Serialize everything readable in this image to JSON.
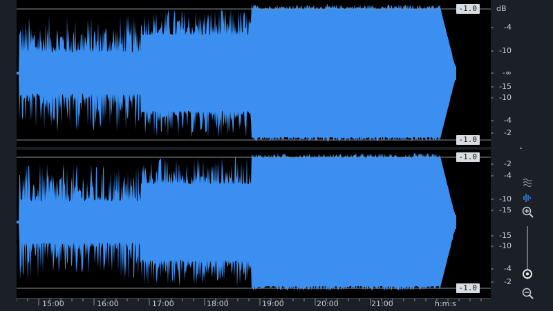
{
  "waveform": {
    "clip_labels": [
      "-1.0",
      "-1.0",
      "-1.0",
      "-1.0"
    ],
    "colors": {
      "wave": "#3b8ff0",
      "background": "#000000",
      "clip_line": "#8a9099"
    }
  },
  "meter": {
    "unit": "dB",
    "top_channel_labels": [
      "-4",
      "-10",
      "-∞",
      "-15",
      "-10",
      "-4",
      "-2"
    ],
    "bottom_channel_labels": [
      "-2",
      "-4",
      "-10",
      "-15",
      "-15",
      "-10",
      "-4",
      "-2"
    ]
  },
  "timeline": {
    "labels": [
      "15:00",
      "16:00",
      "17:00",
      "18:00",
      "19:00",
      "20:00",
      "21:00"
    ],
    "unit_label": "h:m:s"
  },
  "tools": {
    "icons": [
      "spectrogram-icon",
      "waveform-icon",
      "zoom-in-icon",
      "zoom-slider",
      "zoom-out-icon"
    ],
    "zoom_level": 0.25
  }
}
